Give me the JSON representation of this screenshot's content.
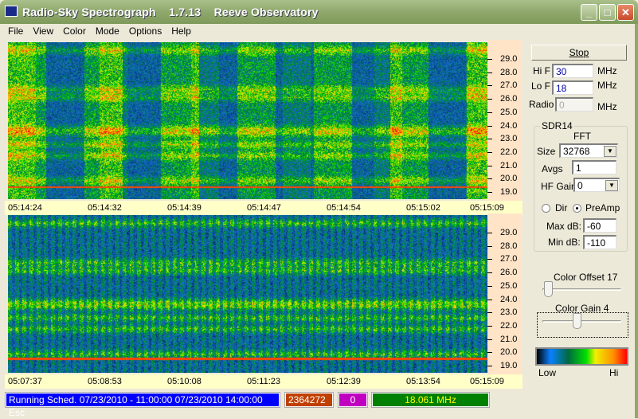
{
  "window": {
    "title": "Radio-Sky Spectrograph    1.7.13    Reeve Observatory",
    "minimize": "_",
    "maximize": "□",
    "close": "✕"
  },
  "menu": [
    "File",
    "View",
    "Color",
    "Mode",
    "Options",
    "Help"
  ],
  "spectrogram_top": {
    "freq_ticks": [
      "29.0",
      "28.0",
      "27.0",
      "26.0",
      "25.0",
      "24.0",
      "23.0",
      "22.0",
      "21.0",
      "20.0",
      "19.0"
    ],
    "times": [
      "05:14:24",
      "05:14:32",
      "05:14:39",
      "05:14:47",
      "05:14:54",
      "05:15:02",
      "05:15:09"
    ]
  },
  "spectrogram_bottom": {
    "freq_ticks": [
      "29.0",
      "28.0",
      "27.0",
      "26.0",
      "25.0",
      "24.0",
      "23.0",
      "22.0",
      "21.0",
      "20.0",
      "19.0"
    ],
    "times": [
      "05:07:37",
      "05:08:53",
      "05:10:08",
      "05:11:23",
      "05:12:39",
      "05:13:54",
      "05:15:09"
    ]
  },
  "controls": {
    "stop": "Stop",
    "hif_label": "Hi F",
    "hif": "30",
    "lof_label": "Lo F",
    "lof": "18",
    "radio_label": "Radio",
    "radio": "0",
    "unit": "MHz",
    "group": "SDR14",
    "fft": "FFT",
    "size_label": "Size",
    "size": "32768",
    "avgs_label": "Avgs",
    "avgs": "1",
    "hfgain_label": "HF Gain",
    "hfgain": "0",
    "dir": "Dir",
    "preamp": "PreAmp",
    "selected_mode": "PreAmp",
    "maxdb_label": "Max dB:",
    "maxdb": "-60",
    "mindb_label": "Min dB:",
    "mindb": "-110",
    "offset_label": "Color Offset 17",
    "offset_value": 17,
    "gain_label": "Color Gain 4",
    "gain_value": 4,
    "low": "Low",
    "hi": "Hi"
  },
  "status": {
    "sched": "Running Sched.  07/23/2010 - 11:00:00 07/23/2010  14:00:00 Esc",
    "count": "2364272",
    "zero": "0",
    "freq": "18.061 MHz",
    "colors": {
      "sched": "#0000ff",
      "count": "#c04000",
      "zero": "#c000c0",
      "freq": "#008000"
    }
  }
}
